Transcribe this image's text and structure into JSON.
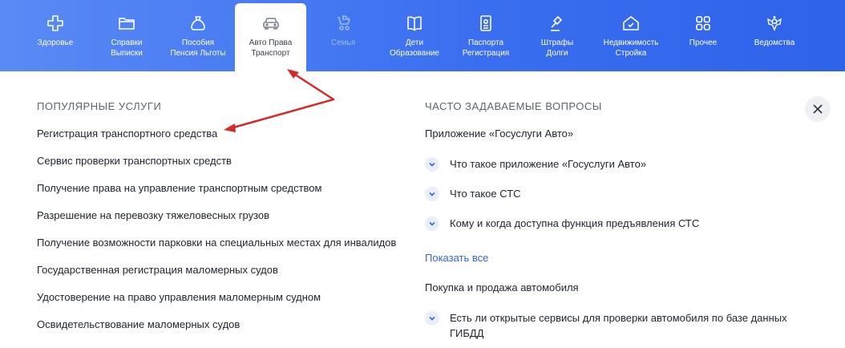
{
  "nav": {
    "categories": [
      {
        "l1": "Здоровье",
        "l2": "",
        "icon": "plus-icon"
      },
      {
        "l1": "Справки",
        "l2": "Выписки",
        "icon": "folder-icon"
      },
      {
        "l1": "Пособия",
        "l2": "Пенсия Льготы",
        "icon": "bag-icon"
      },
      {
        "l1": "Авто Права",
        "l2": "Транспорт",
        "icon": "car-icon"
      },
      {
        "l1": "Семья",
        "l2": "",
        "icon": "stroller-icon"
      },
      {
        "l1": "Дети",
        "l2": "Образование",
        "icon": "book-icon"
      },
      {
        "l1": "Паспорта",
        "l2": "Регистрация",
        "icon": "passport-icon"
      },
      {
        "l1": "Штрафы",
        "l2": "Долги",
        "icon": "gavel-icon"
      },
      {
        "l1": "Недвижимость",
        "l2": "Стройка",
        "icon": "house-icon"
      },
      {
        "l1": "Прочее",
        "l2": "",
        "icon": "grid-icon"
      },
      {
        "l1": "Ведомства",
        "l2": "",
        "icon": "emblem-icon"
      }
    ],
    "active_index": 3,
    "muted_index": 4
  },
  "popular": {
    "title": "ПОПУЛЯРНЫЕ УСЛУГИ",
    "items": [
      "Регистрация транспортного средства",
      "Сервис проверки транспортных средств",
      "Получение права на управление транспортным средством",
      "Разрешение на перевозку тяжеловесных грузов",
      "Получение возможности парковки на специальных местах для инвалидов",
      "Государственная регистрация маломерных судов",
      "Удостоверение на право управления маломерным судном",
      "Освидетельствование маломерных судов"
    ]
  },
  "faq": {
    "title": "ЧАСТО ЗАДАВАЕМЫЕ ВОПРОСЫ",
    "group1": {
      "title": "Приложение «Госуслуги Авто»",
      "questions": [
        "Что такое приложение «Госуслуги Авто»",
        "Что такое СТС",
        "Кому и когда доступна функция предъявления СТС"
      ]
    },
    "show_all": "Показать все",
    "group2": {
      "title": "Покупка и продажа автомобиля",
      "questions": [
        "Есть ли открытые сервисы для проверки автомобиля по базе данных ГИБДД"
      ]
    }
  },
  "colors": {
    "nav_bg": "#3b6ff0",
    "link": "#3466d6",
    "arrow": "#d42a2a"
  },
  "icons": {
    "close": "close-icon",
    "chevron": "chevron-down-icon"
  }
}
